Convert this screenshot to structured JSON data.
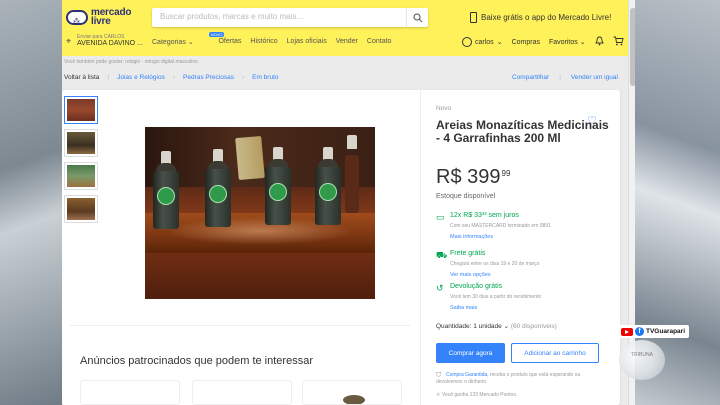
{
  "header": {
    "logo_line1": "mercado",
    "logo_line2": "livre",
    "search_placeholder": "Buscar produtos, marcas e muito mais…",
    "promo_text": "Baixe grátis o app do Mercado Livre!",
    "location_small": "Enviar para CARLOS",
    "location_main": "AVENIDA DAVINO ...",
    "nav": [
      "Categorias",
      "Ofertas",
      "Histórico",
      "Lojas oficiais",
      "Vender",
      "Contato"
    ],
    "offers_badge": "NOVO",
    "user": "carlos",
    "purchases": "Compras",
    "favorites": "Favoritos"
  },
  "breadcrumb": {
    "top_line": "Você também pode gostar: relogio · relogio digital masculino",
    "back": "Voltar à lista",
    "items": [
      "Joias e Relógios",
      "Pedras Preciosas",
      "Em bruto"
    ],
    "share": "Compartilhar",
    "sell_same": "Vender um igual"
  },
  "product": {
    "condition": "Novo",
    "title": "Areias Monazíticas Medicinais - 4 Garrafinhas 200 Ml",
    "price_main": "R$ 399",
    "price_cents": "99",
    "stock": "Estoque disponível",
    "installments_main": "12x R$ 33³³ sem juros",
    "installments_sub": "Com seu MASTERCARD terminado em 0891",
    "installments_link": "Mais informações",
    "shipping_main": "Frete grátis",
    "shipping_sub": "Chegará entre os dias 19 e 20 de março",
    "shipping_link": "Ver mais opções",
    "return_main": "Devolução grátis",
    "return_sub": "Você tem 30 dias a partir do recebimento",
    "return_link": "Saiba mais",
    "quantity_label": "Quantidade: 1 unidade",
    "quantity_available": "(60 disponíveis)",
    "buy_button": "Comprar agora",
    "cart_button": "Adicionar ao carrinho",
    "guarantee_link": "Compra Garantida,",
    "guarantee_text": " receba o produto que está esperando ou devolvemos o dinheiro.",
    "points": "Você ganha 133 Mercado Pontos."
  },
  "sponsored": {
    "title": "Anúncios patrocinados que podem te interessar"
  },
  "overlay": {
    "handle": "TVGuarapari",
    "fb_letter": "f",
    "channel": "TRIBUNA"
  }
}
